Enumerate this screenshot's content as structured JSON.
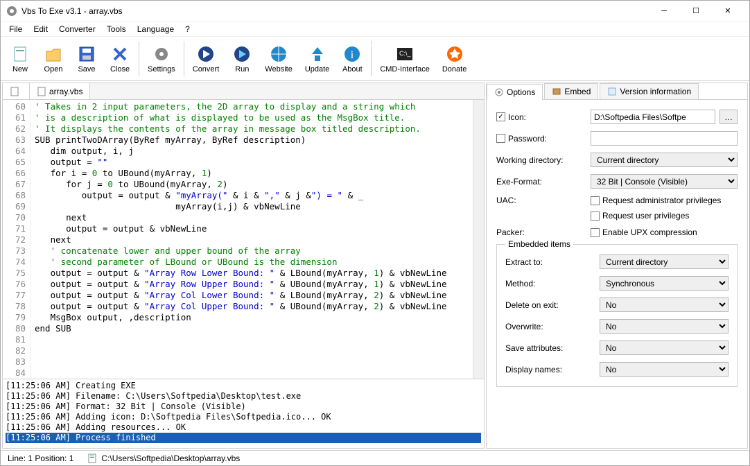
{
  "title": "Vbs To Exe v3.1 - array.vbs",
  "menu": [
    "File",
    "Edit",
    "Converter",
    "Tools",
    "Language",
    "?"
  ],
  "toolbar": [
    {
      "id": "new",
      "label": "New"
    },
    {
      "id": "open",
      "label": "Open"
    },
    {
      "id": "save",
      "label": "Save"
    },
    {
      "id": "close",
      "label": "Close"
    },
    {
      "sep": true
    },
    {
      "id": "settings",
      "label": "Settings"
    },
    {
      "sep": true
    },
    {
      "id": "convert",
      "label": "Convert"
    },
    {
      "id": "run",
      "label": "Run"
    },
    {
      "id": "website",
      "label": "Website"
    },
    {
      "id": "update",
      "label": "Update"
    },
    {
      "id": "about",
      "label": "About"
    },
    {
      "sep": true
    },
    {
      "id": "cmd",
      "label": "CMD-Interface"
    },
    {
      "id": "donate",
      "label": "Donate"
    }
  ],
  "editor_tabs": [
    {
      "label": "<New>"
    },
    {
      "label": "array.vbs",
      "active": true
    }
  ],
  "gutter_start": 60,
  "gutter_end": 84,
  "code_lines": [
    {
      "comment": "' Takes in 2 input parameters, the 2D array to display and a string which"
    },
    {
      "comment": "' is a description of what is displayed to be used as the MsgBox title."
    },
    {
      "comment": "' It displays the contents of the array in message box titled description."
    },
    {
      "plain": "SUB printTwoDArray(ByRef myArray, ByRef description)"
    },
    {
      "plain": "   dim output, i, j"
    },
    {
      "segments": [
        {
          "t": "   output = ",
          "c": "ident"
        },
        {
          "t": "\"\"",
          "c": "string"
        }
      ]
    },
    {
      "segments": [
        {
          "t": "   for i = ",
          "c": "ident"
        },
        {
          "t": "0",
          "c": "number"
        },
        {
          "t": " to UBound(myArray, ",
          "c": "ident"
        },
        {
          "t": "1",
          "c": "number"
        },
        {
          "t": ")",
          "c": "ident"
        }
      ]
    },
    {
      "segments": [
        {
          "t": "      for j = ",
          "c": "ident"
        },
        {
          "t": "0",
          "c": "number"
        },
        {
          "t": " to UBound(myArray, ",
          "c": "ident"
        },
        {
          "t": "2",
          "c": "number"
        },
        {
          "t": ")",
          "c": "ident"
        }
      ]
    },
    {
      "segments": [
        {
          "t": "         output = output & ",
          "c": "ident"
        },
        {
          "t": "\"myArray(\"",
          "c": "string"
        },
        {
          "t": " & i & ",
          "c": "ident"
        },
        {
          "t": "\",\"",
          "c": "string"
        },
        {
          "t": " & j &",
          "c": "ident"
        },
        {
          "t": "\") = \"",
          "c": "string"
        },
        {
          "t": " & _",
          "c": "ident"
        }
      ]
    },
    {
      "plain": "                           myArray(i,j) & vbNewLine"
    },
    {
      "plain": "      next"
    },
    {
      "plain": "      output = output & vbNewLine"
    },
    {
      "plain": "   next"
    },
    {
      "plain": ""
    },
    {
      "comment": "   ' concatenate lower and upper bound of the array"
    },
    {
      "comment": "   ' second parameter of LBound or UBound is the dimension"
    },
    {
      "segments": [
        {
          "t": "   output = output & ",
          "c": "ident"
        },
        {
          "t": "\"Array Row Lower Bound: \"",
          "c": "string"
        },
        {
          "t": " & LBound(myArray, ",
          "c": "ident"
        },
        {
          "t": "1",
          "c": "number"
        },
        {
          "t": ") & vbNewLine",
          "c": "ident"
        }
      ]
    },
    {
      "segments": [
        {
          "t": "   output = output & ",
          "c": "ident"
        },
        {
          "t": "\"Array Row Upper Bound: \"",
          "c": "string"
        },
        {
          "t": " & UBound(myArray, ",
          "c": "ident"
        },
        {
          "t": "1",
          "c": "number"
        },
        {
          "t": ") & vbNewLine",
          "c": "ident"
        }
      ]
    },
    {
      "segments": [
        {
          "t": "   output = output & ",
          "c": "ident"
        },
        {
          "t": "\"Array Col Lower Bound: \"",
          "c": "string"
        },
        {
          "t": " & LBound(myArray, ",
          "c": "ident"
        },
        {
          "t": "2",
          "c": "number"
        },
        {
          "t": ") & vbNewLine",
          "c": "ident"
        }
      ]
    },
    {
      "segments": [
        {
          "t": "   output = output & ",
          "c": "ident"
        },
        {
          "t": "\"Array Col Upper Bound: \"",
          "c": "string"
        },
        {
          "t": " & UBound(myArray, ",
          "c": "ident"
        },
        {
          "t": "2",
          "c": "number"
        },
        {
          "t": ") & vbNewLine",
          "c": "ident"
        }
      ]
    },
    {
      "plain": ""
    },
    {
      "plain": "   MsgBox output, ,description"
    },
    {
      "plain": "end SUB"
    },
    {
      "plain": ""
    },
    {
      "plain": ""
    }
  ],
  "log": [
    "[11:25:06 AM] Creating EXE",
    "[11:25:06 AM] Filename: C:\\Users\\Softpedia\\Desktop\\test.exe",
    "[11:25:06 AM] Format: 32 Bit | Console (Visible)",
    "[11:25:06 AM] Adding icon: D:\\Softpedia Files\\Softpedia.ico... OK",
    "[11:25:06 AM] Adding resources... OK",
    "[11:25:06 AM] Process finished"
  ],
  "right_tabs": [
    "Options",
    "Embed",
    "Version information"
  ],
  "options": {
    "icon_label": "Icon:",
    "icon_path": "D:\\Softpedia Files\\Softpe",
    "password_label": "Password:",
    "password_value": "",
    "workdir_label": "Working directory:",
    "workdir_value": "Current directory",
    "exeformat_label": "Exe-Format:",
    "exeformat_value": "32 Bit | Console (Visible)",
    "uac_label": "UAC:",
    "uac_admin": "Request administrator privileges",
    "uac_user": "Request user privileges",
    "packer_label": "Packer:",
    "packer_upx": "Enable UPX compression"
  },
  "embedded": {
    "legend": "Embedded items",
    "extract_label": "Extract to:",
    "extract_value": "Current directory",
    "method_label": "Method:",
    "method_value": "Synchronous",
    "delete_label": "Delete on exit:",
    "delete_value": "No",
    "overwrite_label": "Overwrite:",
    "overwrite_value": "No",
    "saveattr_label": "Save attributes:",
    "saveattr_value": "No",
    "dispnames_label": "Display names:",
    "dispnames_value": "No"
  },
  "status": {
    "pos": "Line: 1 Position: 1",
    "file": "C:\\Users\\Softpedia\\Desktop\\array.vbs"
  }
}
